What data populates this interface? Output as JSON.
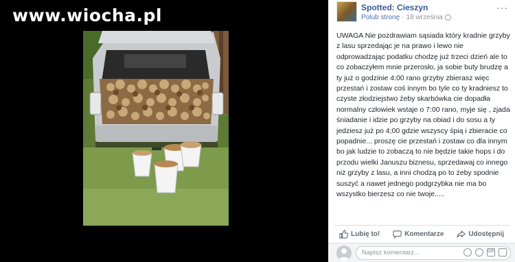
{
  "watermark": {
    "text": "www.wiocha.pl"
  },
  "post": {
    "page_name": "Spotted: Cieszyn",
    "like_page_label": "Polub stronę",
    "separator": "·",
    "date": "18 września",
    "text": "UWAGA Nie pozdrawiam sąsiada który kradnie grzyby z lasu sprzedając je na prawo i lewo nie odprowadzając podatku chodzę już trzeci dzień ale to co zobaczyłem mnie przerosło, ja sobie buty brudzę a ty już o godzinie 4:00 rano grzyby zbierasz więc przestań i zostaw coś innym bo tyle co ty kradniesz to czyste złodziejstwo żeby skarbówka cie dopadła normalny człowiek wstaje o 7:00 rano, myje się , zjada śniadanie i idzie po grzyby na obiad i do sosu a ty jedziesz już po 4;00 gdzie wszyscy śpią i zbieracie co popadnie... proszę cie przestań i zostaw co dla innym bo jak ludzie to zobaczą to nie będzie takie hops i do przodu wielki Januszu biznesu, sprzedawaj co innego niż grzyby z lasu, a inni chodzą po to żeby spodnie suszyć a nawet jednego podgrzybka nie ma bo wszystko bierzesz co nie twoje....."
  },
  "actions": {
    "like": "Lubię to!",
    "comment": "Komentarze",
    "share": "Udostępnij"
  },
  "comment_box": {
    "placeholder": "Napisz komentarz...",
    "icons": [
      "emoji-icon",
      "camera-icon",
      "gif-icon",
      "sticker-icon"
    ]
  },
  "colors": {
    "link_blue": "#365899",
    "text": "#1d2129",
    "muted": "#90949c"
  }
}
